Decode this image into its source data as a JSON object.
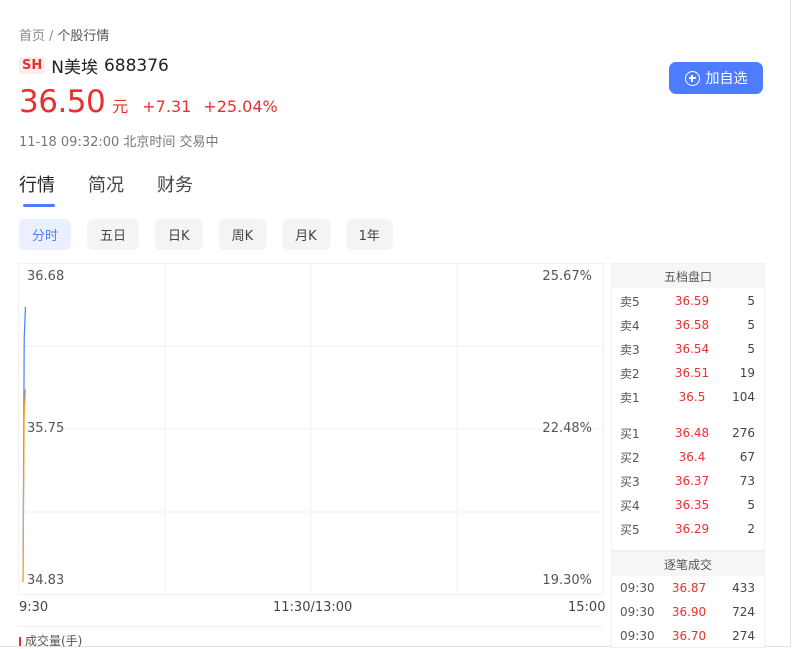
{
  "breadcrumb": {
    "home": "首页",
    "separator": "/",
    "current": "个股行情"
  },
  "stock": {
    "market": "SH",
    "name": "N美埃",
    "code": "688376",
    "price": "36.50",
    "unit": "元",
    "change": "+7.31",
    "change_pct": "+25.04%",
    "timestamp": "11-18 09:32:00 北京时间 交易中"
  },
  "actions": {
    "follow_label": "加自选"
  },
  "tabs": [
    {
      "label": "行情",
      "active": true
    },
    {
      "label": "简况",
      "active": false
    },
    {
      "label": "财务",
      "active": false
    }
  ],
  "periods": [
    {
      "label": "分时",
      "active": true
    },
    {
      "label": "五日",
      "active": false
    },
    {
      "label": "日K",
      "active": false
    },
    {
      "label": "周K",
      "active": false
    },
    {
      "label": "月K",
      "active": false
    },
    {
      "label": "1年",
      "active": false
    }
  ],
  "chart_data": {
    "type": "line",
    "y_price_ticks": [
      "36.68",
      "35.75",
      "34.83"
    ],
    "y_pct_ticks": [
      "25.67%",
      "22.48%",
      "19.30%"
    ],
    "x_ticks": [
      "9:30",
      "11:30/13:00",
      "15:00"
    ],
    "ylim": [
      34.83,
      36.68
    ],
    "series": [
      {
        "color": "#4d7dfe",
        "x": [
          "09:30",
          "09:31",
          "09:32"
        ],
        "y": [
          34.83,
          36.4,
          36.61
        ]
      },
      {
        "color": "#f5a623",
        "x": [
          "09:30",
          "09:31",
          "09:32"
        ],
        "y": [
          34.83,
          35.9,
          36.08
        ]
      }
    ],
    "volume_label": "成交量(手)"
  },
  "orderbook": {
    "title": "五档盘口",
    "asks": [
      {
        "label": "卖5",
        "price": "36.59",
        "volume": "5"
      },
      {
        "label": "卖4",
        "price": "36.58",
        "volume": "5"
      },
      {
        "label": "卖3",
        "price": "36.54",
        "volume": "5"
      },
      {
        "label": "卖2",
        "price": "36.51",
        "volume": "19"
      },
      {
        "label": "卖1",
        "price": "36.5",
        "volume": "104"
      }
    ],
    "bids": [
      {
        "label": "买1",
        "price": "36.48",
        "volume": "276"
      },
      {
        "label": "买2",
        "price": "36.4",
        "volume": "67"
      },
      {
        "label": "买3",
        "price": "36.37",
        "volume": "73"
      },
      {
        "label": "买4",
        "price": "36.35",
        "volume": "5"
      },
      {
        "label": "买5",
        "price": "36.29",
        "volume": "2"
      }
    ]
  },
  "trades": {
    "title": "逐笔成交",
    "rows": [
      {
        "time": "09:30",
        "price": "36.87",
        "volume": "433"
      },
      {
        "time": "09:30",
        "price": "36.90",
        "volume": "724"
      },
      {
        "time": "09:30",
        "price": "36.70",
        "volume": "274"
      }
    ]
  },
  "colors": {
    "up": "#e93030",
    "accent": "#4d7dfe",
    "avg_line": "#f5a623"
  }
}
